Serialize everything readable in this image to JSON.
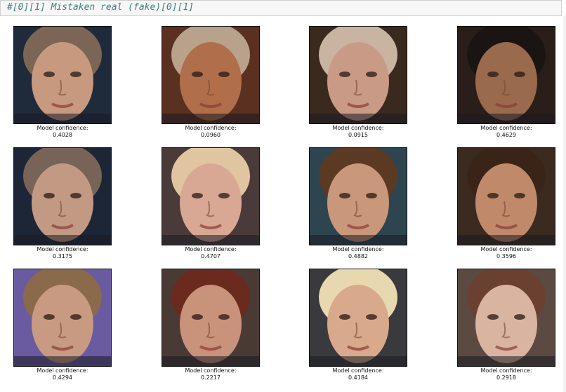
{
  "cell": {
    "code": "#[0][1] Mistaken real (fake)[0][1]"
  },
  "grid": {
    "label": "Model confidence:",
    "tiles": [
      {
        "confidence": "0.4028",
        "bg": "#1f2a3a",
        "skin": "#c79a80",
        "hair": "#7b6655"
      },
      {
        "confidence": "0.0960",
        "bg": "#5a3020",
        "skin": "#b06e4a",
        "hair": "#b8a28c"
      },
      {
        "confidence": "0.0915",
        "bg": "#3a2a1e",
        "skin": "#c99a85",
        "hair": "#c8b4a0"
      },
      {
        "confidence": "0.4629",
        "bg": "#2a1e1a",
        "skin": "#9a6a4c",
        "hair": "#1a1412"
      },
      {
        "confidence": "0.3175",
        "bg": "#1c2636",
        "skin": "#c29a84",
        "hair": "#786456"
      },
      {
        "confidence": "0.4707",
        "bg": "#4a3a3a",
        "skin": "#d9a894",
        "hair": "#e0c6a0"
      },
      {
        "confidence": "0.4882",
        "bg": "#2e4550",
        "skin": "#c9977a",
        "hair": "#5a3a22"
      },
      {
        "confidence": "0.3596",
        "bg": "#3a2a20",
        "skin": "#c08a6a",
        "hair": "#3a2418"
      },
      {
        "confidence": "0.4294",
        "bg": "#6a5aa0",
        "skin": "#c99a82",
        "hair": "#8a6a4a"
      },
      {
        "confidence": "0.2217",
        "bg": "#4a3a36",
        "skin": "#c9927a",
        "hair": "#6a2a1e"
      },
      {
        "confidence": "0.4184",
        "bg": "#3a3a3e",
        "skin": "#d8a98a",
        "hair": "#e8d8b0"
      },
      {
        "confidence": "0.2918",
        "bg": "#5a4a42",
        "skin": "#d9b4a0",
        "hair": "#6a4030"
      }
    ]
  }
}
